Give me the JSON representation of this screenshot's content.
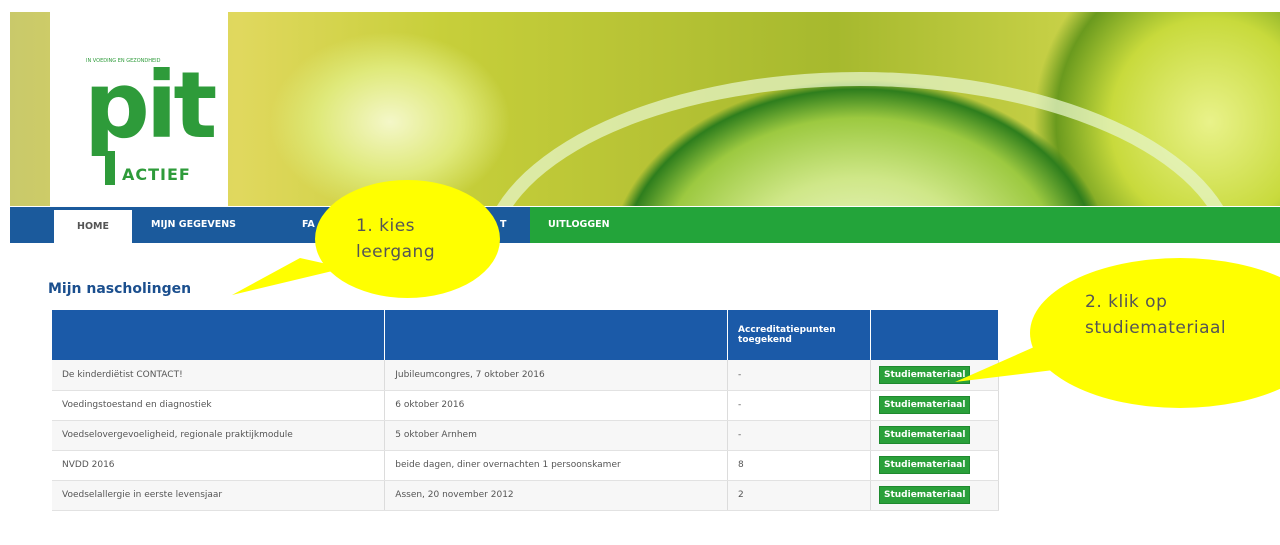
{
  "logo": {
    "tagline": "IN VOEDING EN GEZONDHEID",
    "wordmark": "pit",
    "sub": "ACTIEF"
  },
  "nav": {
    "items": [
      {
        "label": "HOME"
      },
      {
        "label": "MIJN GEGEVENS"
      },
      {
        "label": "FA"
      },
      {
        "label": "T"
      },
      {
        "label": "UITLOGGEN"
      }
    ]
  },
  "main": {
    "title": "Mijn nascholingen",
    "table": {
      "headers": [
        "",
        "",
        "Accreditatiepunten toegekend",
        ""
      ],
      "rows": [
        {
          "name": "De kinderdiëtist CONTACT!",
          "detail": "Jubileumcongres, 7 oktober 2016",
          "points": "-",
          "button": "Studiemateriaal"
        },
        {
          "name": "Voedingstoestand en diagnostiek",
          "detail": "6 oktober 2016",
          "points": "-",
          "button": "Studiemateriaal"
        },
        {
          "name": "Voedselovergevoeligheid, regionale praktijkmodule",
          "detail": "5 oktober Arnhem",
          "points": "-",
          "button": "Studiemateriaal"
        },
        {
          "name": "NVDD 2016",
          "detail": "beide dagen, diner overnachten 1 persoonskamer",
          "points": "8",
          "button": "Studiemateriaal"
        },
        {
          "name": "Voedselallergie in eerste levensjaar",
          "detail": "Assen, 20 november 2012",
          "points": "2",
          "button": "Studiemateriaal"
        }
      ]
    }
  },
  "callouts": {
    "first": "1. kies leergang",
    "second": "2. klik op studiemateriaal"
  },
  "colors": {
    "nav_blue": "#1b5a9c",
    "nav_green": "#23a43a",
    "table_header": "#1b5aa8",
    "button_green": "#2aa03a",
    "callout": "#ffff00"
  }
}
